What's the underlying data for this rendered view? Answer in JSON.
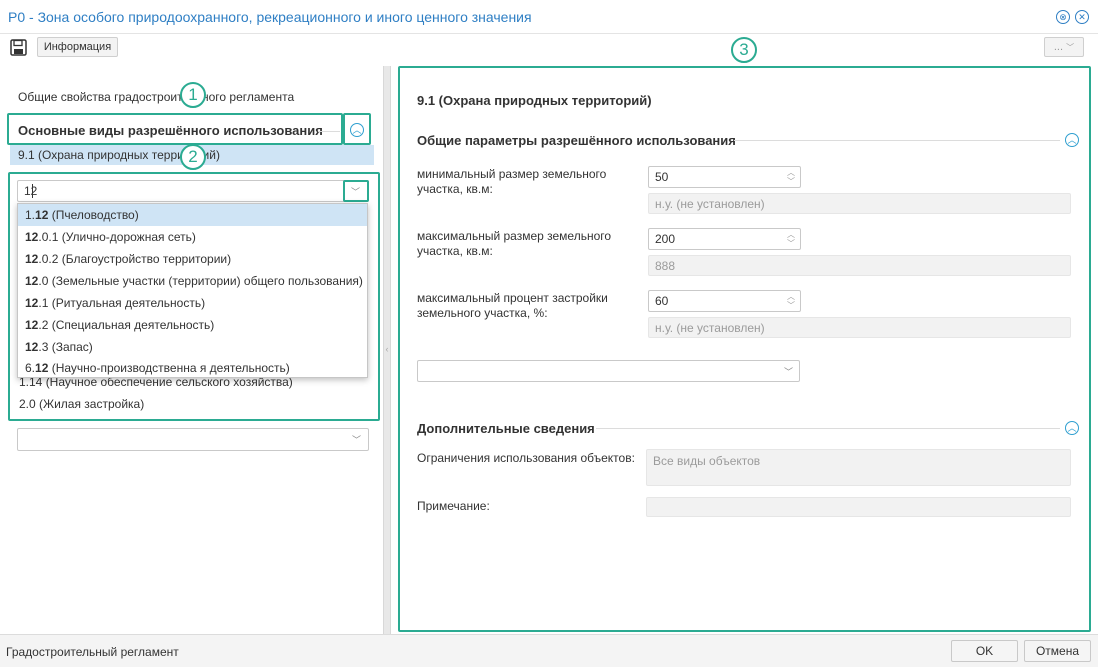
{
  "window": {
    "title": "Р0 - Зона особого природоохранного, рекреационного и иного ценного значения",
    "pin_icon": "pin-icon",
    "close_icon": "close-icon"
  },
  "toolbar": {
    "save_icon": "floppy-disk-icon",
    "info_label": "Информация",
    "more_label": "..."
  },
  "callouts": [
    "1",
    "2",
    "3"
  ],
  "left": {
    "general_props": "Общие свойства градостроительного регламента",
    "section_title": "Основные виды разрешённого использования",
    "selected_item": "9.1 (Охрана природных территорий)",
    "combo_value": "12",
    "dropdown_items": [
      {
        "before": "1.",
        "match": "12",
        "after": " (Пчеловодство)"
      },
      {
        "before": "",
        "match": "12",
        "after": ".0.1 (Улично-дорожная сеть)"
      },
      {
        "before": "",
        "match": "12",
        "after": ".0.2 (Благоустройство территории)"
      },
      {
        "before": "",
        "match": "12",
        "after": ".0 (Земельные участки (территории) общего пользования)"
      },
      {
        "before": "",
        "match": "12",
        "after": ".1 (Ритуальная деятельность)"
      },
      {
        "before": "",
        "match": "12",
        "after": ".2 (Специальная деятельность)"
      },
      {
        "before": "",
        "match": "12",
        "after": ".3 (Запас)"
      },
      {
        "before": "6.",
        "match": "12",
        "after": " (Научно-производственна я деятельность)"
      }
    ],
    "list_below": [
      "1.14 (Научное обеспечение сельского хозяйства)",
      "2.0 (Жилая застройка)"
    ],
    "bottom_combo_value": ""
  },
  "right": {
    "heading": "9.1 (Охрана природных территорий)",
    "params_section": "Общие параметры разрешённого использования",
    "params": [
      {
        "label_1": "минимальный размер земельного",
        "label_2": "участка, кв.м:",
        "value": "50",
        "hint": "н.у. (не установлен)"
      },
      {
        "label_1": "максимальный размер земельного",
        "label_2": "участка, кв.м:",
        "value": "200",
        "hint": "888"
      },
      {
        "label_1": "максимальный процент застройки",
        "label_2": "земельного участка, %:",
        "value": "60",
        "hint": "н.у. (не установлен)"
      }
    ],
    "extra_combo_value": "",
    "extra_section": "Дополнительные сведения",
    "restrictions_label": "Ограничения использования объектов:",
    "restrictions_value": "Все виды объектов",
    "note_label": "Примечание:",
    "note_value": ""
  },
  "status": {
    "text": "Градостроительный регламент",
    "ok_label": "OK",
    "cancel_label": "Отмена"
  },
  "colors": {
    "accent": "#2bab92",
    "title": "#2f7fc4",
    "selection": "#cfe4f5"
  }
}
